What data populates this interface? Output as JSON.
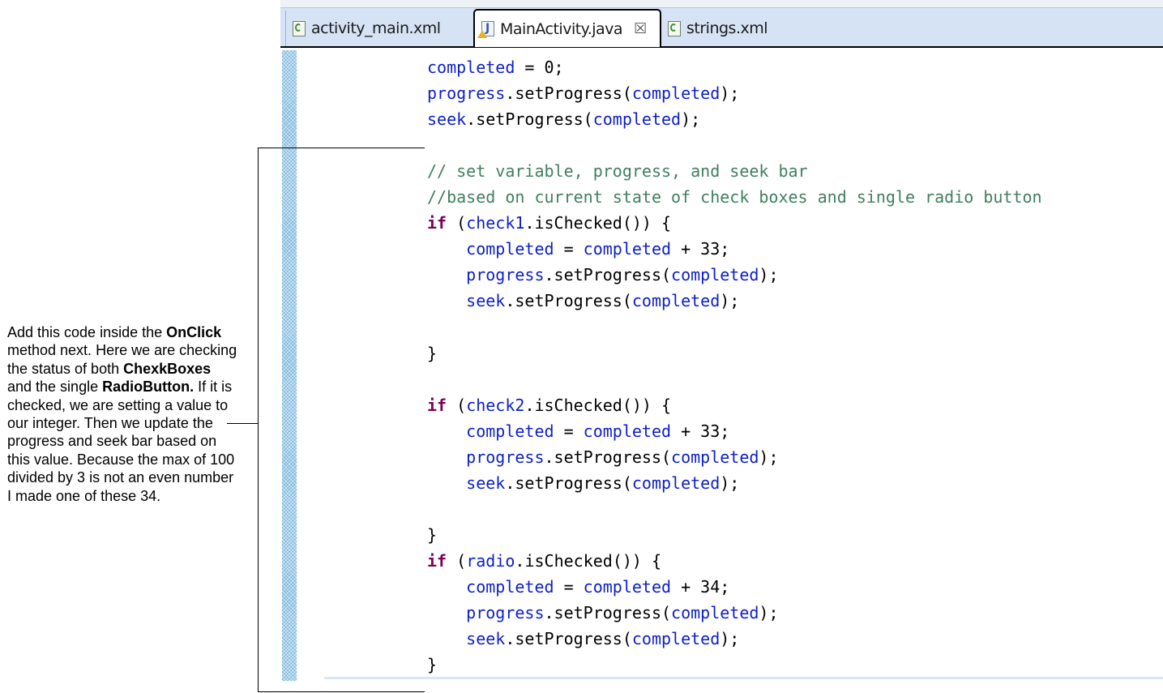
{
  "tabs": [
    {
      "label": "activity_main.xml",
      "icon": "xml-file-icon",
      "active": false
    },
    {
      "label": "MainActivity.java",
      "icon": "java-file-warning-icon",
      "active": true,
      "close_glyph": "☒"
    },
    {
      "label": "strings.xml",
      "icon": "xml-file-icon",
      "active": false
    }
  ],
  "code_lines": [
    [
      {
        "t": "completed",
        "c": "var"
      },
      {
        "t": " = 0;",
        "c": "pl"
      }
    ],
    [
      {
        "t": "progress",
        "c": "var"
      },
      {
        "t": ".setProgress(",
        "c": "pl"
      },
      {
        "t": "completed",
        "c": "var"
      },
      {
        "t": ");",
        "c": "pl"
      }
    ],
    [
      {
        "t": "seek",
        "c": "var"
      },
      {
        "t": ".setProgress(",
        "c": "pl"
      },
      {
        "t": "completed",
        "c": "var"
      },
      {
        "t": ");",
        "c": "pl"
      }
    ],
    [],
    [
      {
        "t": "// set variable, progress, and seek bar",
        "c": "cm"
      }
    ],
    [
      {
        "t": "//based on current state of check boxes and single radio button",
        "c": "cm"
      }
    ],
    [
      {
        "t": "if",
        "c": "kw"
      },
      {
        "t": " (",
        "c": "pl"
      },
      {
        "t": "check1",
        "c": "var"
      },
      {
        "t": ".isChecked()) {",
        "c": "pl"
      }
    ],
    [
      {
        "t": "    ",
        "c": "pl"
      },
      {
        "t": "completed",
        "c": "var"
      },
      {
        "t": " = ",
        "c": "pl"
      },
      {
        "t": "completed",
        "c": "var"
      },
      {
        "t": " + 33;",
        "c": "pl"
      }
    ],
    [
      {
        "t": "    ",
        "c": "pl"
      },
      {
        "t": "progress",
        "c": "var"
      },
      {
        "t": ".setProgress(",
        "c": "pl"
      },
      {
        "t": "completed",
        "c": "var"
      },
      {
        "t": ");",
        "c": "pl"
      }
    ],
    [
      {
        "t": "    ",
        "c": "pl"
      },
      {
        "t": "seek",
        "c": "var"
      },
      {
        "t": ".setProgress(",
        "c": "pl"
      },
      {
        "t": "completed",
        "c": "var"
      },
      {
        "t": ");",
        "c": "pl"
      }
    ],
    [],
    [
      {
        "t": "}",
        "c": "pl"
      }
    ],
    [],
    [
      {
        "t": "if",
        "c": "kw"
      },
      {
        "t": " (",
        "c": "pl"
      },
      {
        "t": "check2",
        "c": "var"
      },
      {
        "t": ".isChecked()) {",
        "c": "pl"
      }
    ],
    [
      {
        "t": "    ",
        "c": "pl"
      },
      {
        "t": "completed",
        "c": "var"
      },
      {
        "t": " = ",
        "c": "pl"
      },
      {
        "t": "completed",
        "c": "var"
      },
      {
        "t": " + 33;",
        "c": "pl"
      }
    ],
    [
      {
        "t": "    ",
        "c": "pl"
      },
      {
        "t": "progress",
        "c": "var"
      },
      {
        "t": ".setProgress(",
        "c": "pl"
      },
      {
        "t": "completed",
        "c": "var"
      },
      {
        "t": ");",
        "c": "pl"
      }
    ],
    [
      {
        "t": "    ",
        "c": "pl"
      },
      {
        "t": "seek",
        "c": "var"
      },
      {
        "t": ".setProgress(",
        "c": "pl"
      },
      {
        "t": "completed",
        "c": "var"
      },
      {
        "t": ");",
        "c": "pl"
      }
    ],
    [],
    [
      {
        "t": "}",
        "c": "pl"
      }
    ],
    [
      {
        "t": "if",
        "c": "kw"
      },
      {
        "t": " (",
        "c": "pl"
      },
      {
        "t": "radio",
        "c": "var"
      },
      {
        "t": ".isChecked()) {",
        "c": "pl"
      }
    ],
    [
      {
        "t": "    ",
        "c": "pl"
      },
      {
        "t": "completed",
        "c": "var"
      },
      {
        "t": " = ",
        "c": "pl"
      },
      {
        "t": "completed",
        "c": "var"
      },
      {
        "t": " + 34;",
        "c": "pl"
      }
    ],
    [
      {
        "t": "    ",
        "c": "pl"
      },
      {
        "t": "progress",
        "c": "var"
      },
      {
        "t": ".setProgress(",
        "c": "pl"
      },
      {
        "t": "completed",
        "c": "var"
      },
      {
        "t": ");",
        "c": "pl"
      }
    ],
    [
      {
        "t": "    ",
        "c": "pl"
      },
      {
        "t": "seek",
        "c": "var"
      },
      {
        "t": ".setProgress(",
        "c": "pl"
      },
      {
        "t": "completed",
        "c": "var"
      },
      {
        "t": ");",
        "c": "pl"
      }
    ],
    [
      {
        "t": "}",
        "c": "pl"
      }
    ]
  ],
  "note": {
    "parts": [
      {
        "t": "Add this code inside the ",
        "b": false
      },
      {
        "t": "OnClick",
        "b": true
      },
      {
        "t": " method next. Here we are checking the status of both ",
        "b": false
      },
      {
        "t": "ChexkBoxes",
        "b": true
      },
      {
        "t": " and the single ",
        "b": false
      },
      {
        "t": "RadioButton.",
        "b": true
      },
      {
        "t": " If it is checked, we are setting a value to our integer. Then we update the progress and seek bar based on this value. Because the max of 100 divided by 3 is not an even number I made one of these 34.",
        "b": false
      }
    ]
  },
  "colors": {
    "variable": "#0d1fc7",
    "keyword": "#7f0055",
    "comment": "#3f7f5f",
    "plain": "#000000",
    "ruler": "#7fb9df",
    "tabbar": "#d6e3f5"
  }
}
